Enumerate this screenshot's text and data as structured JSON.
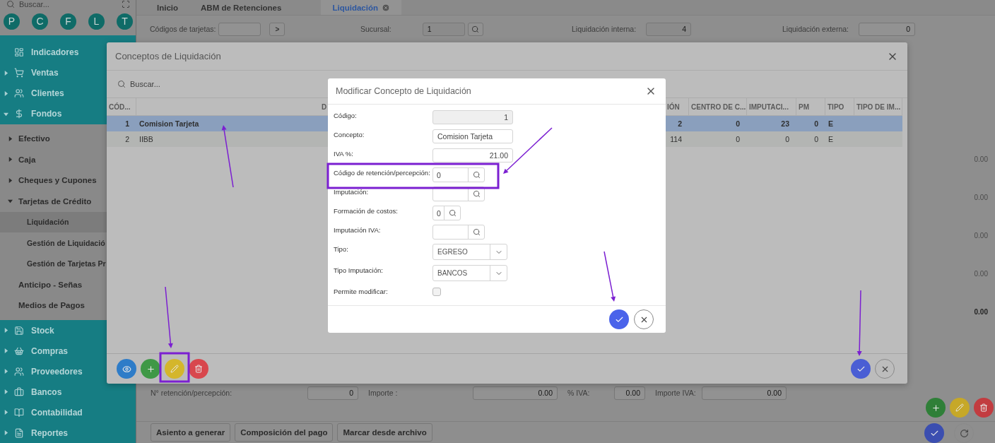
{
  "sidebar": {
    "search_placeholder": "Buscar...",
    "shortcuts": [
      "P",
      "C",
      "F",
      "L",
      "T"
    ],
    "menu": [
      {
        "label": "Indicadores",
        "kind": "leaf"
      },
      {
        "label": "Ventas",
        "kind": "folder",
        "expanded": false
      },
      {
        "label": "Clientes",
        "kind": "folder",
        "expanded": false
      },
      {
        "label": "Fondos",
        "kind": "folder",
        "expanded": true,
        "children": [
          {
            "label": "Efectivo",
            "kind": "folder",
            "expanded": false
          },
          {
            "label": "Caja",
            "kind": "folder",
            "expanded": false
          },
          {
            "label": "Cheques y Cupones",
            "kind": "folder",
            "expanded": false
          },
          {
            "label": "Tarjetas de Crédito",
            "kind": "folder",
            "expanded": true,
            "children": [
              {
                "label": "Liquidación",
                "selected": true
              },
              {
                "label": "Gestión de Liquidació",
                "selected": false
              },
              {
                "label": "Gestión de Tarjetas Pr",
                "selected": false
              }
            ]
          },
          {
            "label": "Anticipo - Señas",
            "kind": "leaf"
          },
          {
            "label": "Medios de Pagos",
            "kind": "leaf"
          }
        ]
      },
      {
        "label": "Stock",
        "kind": "folder",
        "expanded": false
      },
      {
        "label": "Compras",
        "kind": "folder",
        "expanded": false
      },
      {
        "label": "Proveedores",
        "kind": "folder",
        "expanded": false
      },
      {
        "label": "Bancos",
        "kind": "folder",
        "expanded": false
      },
      {
        "label": "Contabilidad",
        "kind": "folder",
        "expanded": false
      },
      {
        "label": "Reportes",
        "kind": "folder",
        "expanded": false
      }
    ]
  },
  "tabs": [
    {
      "label": "Inicio",
      "selected": false
    },
    {
      "label": "ABM de Retenciones",
      "selected": false
    },
    {
      "label": "Liquidación",
      "selected": true
    }
  ],
  "filters": [
    {
      "label": "Códigos de tarjetas:",
      "kind": "action",
      "action": ">"
    },
    {
      "label": "Sucursal:",
      "kind": "lookup",
      "value": "1"
    },
    {
      "label": "Liquidación interna:",
      "kind": "readonly",
      "value": "4"
    },
    {
      "label": "Liquidación externa:",
      "kind": "input",
      "value": "0"
    }
  ],
  "totals": [
    {
      "value": "0.00",
      "kind": "line"
    },
    {
      "value": "0.00",
      "kind": "line"
    },
    {
      "value": "0.00",
      "kind": "line"
    },
    {
      "value": "0.00",
      "kind": "line"
    },
    {
      "value": "0.00",
      "kind": "total"
    }
  ],
  "detail_fields": [
    {
      "label": "N° retención/percepción:",
      "value": "0"
    },
    {
      "label": "Importe :",
      "value": "0.00"
    },
    {
      "label": "% IVA:",
      "value": "0.00"
    },
    {
      "label": "Importe IVA:",
      "value": "0.00"
    }
  ],
  "actions": [
    "Asiento a generar",
    "Composición del pago",
    "Marcar desde archivo"
  ],
  "conceptos_modal": {
    "title": "Conceptos de Liquidación",
    "search_placeholder": "Buscar...",
    "columns": [
      "CÓD...",
      "D",
      "IÓN",
      "CENTRO DE C...",
      "IMPUTACI...",
      "PM",
      "TIPO",
      "TIPO DE IM..."
    ],
    "rows": [
      {
        "selected": true,
        "cells": [
          "1",
          "Comision Tarjeta",
          "2",
          "0",
          "23",
          "0",
          "E"
        ]
      },
      {
        "selected": false,
        "cells": [
          "2",
          "IIBB",
          "114",
          "0",
          "0",
          "0",
          "E"
        ]
      }
    ]
  },
  "edit_modal": {
    "title": "Modificar Concepto de Liquidación",
    "fields": [
      {
        "label": "Código:",
        "kind": "readonly",
        "value": "1"
      },
      {
        "label": "Concepto:",
        "kind": "text",
        "value": "Comision Tarjeta"
      },
      {
        "label": "IVA %:",
        "kind": "number",
        "value": "21.00"
      },
      {
        "label": "Código de retención/percepción:",
        "kind": "lookup",
        "value": "0"
      },
      {
        "label": "Imputación:",
        "kind": "lookup"
      },
      {
        "label": "Formación de costos:",
        "kind": "short_lookup",
        "value": "0"
      },
      {
        "label": "Imputación IVA:",
        "kind": "lookup"
      },
      {
        "label": "Tipo:",
        "kind": "select",
        "value": "EGRESO"
      },
      {
        "label": "Tipo Imputación:",
        "kind": "select",
        "value": "BANCOS"
      },
      {
        "label": "Permite modificar:",
        "kind": "checkbox",
        "checked": false
      }
    ]
  }
}
